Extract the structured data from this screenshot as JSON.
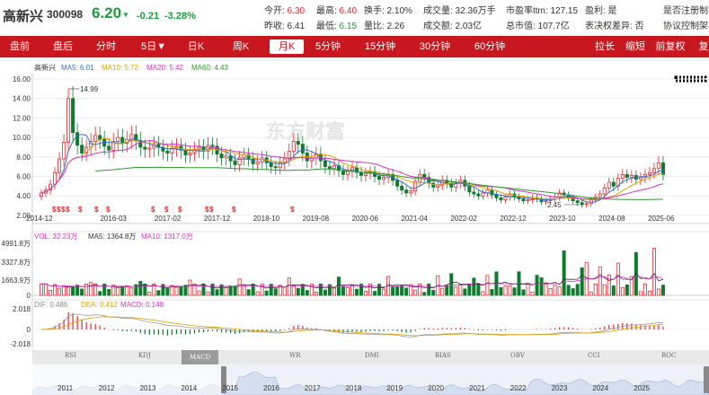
{
  "header": {
    "stock_name": "高新兴",
    "stock_code": "300098",
    "price": "6.20",
    "change": "-0.21",
    "change_pct": "-3.28%",
    "quotes": [
      {
        "label": "今开:",
        "value": "6.30",
        "color": "red"
      },
      {
        "label": "最高:",
        "value": "6.40",
        "color": "red"
      },
      {
        "label": "换手:",
        "value": "2.10%",
        "color": "none"
      },
      {
        "label": "成交量:",
        "value": "32.36万手",
        "color": "none"
      },
      {
        "label": "市盈率ttm:",
        "value": "127.15",
        "color": "none"
      },
      {
        "label": "盈利:",
        "value": "是",
        "color": "none"
      },
      {
        "label": "是否注册制:",
        "value": "",
        "color": "none"
      },
      {
        "label": "昨收:",
        "value": "6.41",
        "color": "none"
      },
      {
        "label": "最低:",
        "value": "6.15",
        "color": "green"
      },
      {
        "label": "量比:",
        "value": "2.26",
        "color": "none"
      },
      {
        "label": "成交额:",
        "value": "2.03亿",
        "color": "none"
      },
      {
        "label": "总市值:",
        "value": "107.7亿",
        "color": "none"
      },
      {
        "label": "表决权差异:",
        "value": "否",
        "color": "none"
      },
      {
        "label": "协议控制架构",
        "value": "",
        "color": "none"
      }
    ]
  },
  "toolbar": {
    "periods": [
      "盘前",
      "盘后",
      "分时",
      "5日▼",
      "日K",
      "周K",
      "月K",
      "5分钟",
      "15分钟",
      "30分钟",
      "60分钟"
    ],
    "active_period": "月K",
    "right_buttons": [
      "拉长",
      "缩短",
      "前复权▼",
      "复"
    ]
  },
  "legend": {
    "name": "高新兴",
    "ma5": "MA5: 6.01",
    "ma10": "MA10: 5.72",
    "ma20": "MA20: 5.42",
    "ma60": "MA60: 4.43"
  },
  "price_axis": [
    "16.00",
    "14.00",
    "12.00",
    "10.00",
    "8.00",
    "6.00",
    "4.00",
    "2.00"
  ],
  "date_axis": [
    "2014-12",
    "2016-03",
    "2017-02",
    "2017-12",
    "2018-10",
    "2019-08",
    "2020-06",
    "2021-04",
    "2022-02",
    "2022-12",
    "2023-10",
    "2024-08",
    "2025-06"
  ],
  "annotations": {
    "high": "14.99",
    "low": "2.45",
    "event_marker": "$"
  },
  "watermark": "东方财富",
  "volume": {
    "axis": [
      "4991.8万",
      "3327.8万",
      "1663.9万",
      "0"
    ],
    "vol": "VOL: 32.23万",
    "ma5": "MA5: 1364.8万",
    "ma10": "MA10: 1317.0万"
  },
  "macd": {
    "axis": [
      "2.018",
      "0",
      "-2.018"
    ],
    "dif": "DIF: 0.486",
    "dea": "DEA: 0.412",
    "macd": "MACD: 0.148"
  },
  "indicator_tabs": [
    "RSI",
    "KDJ",
    "MACD",
    "WR",
    "DMI",
    "BIAS",
    "OBV",
    "CCI",
    "ROC"
  ],
  "active_indicator": "MACD",
  "navigator_years": [
    "2011",
    "2012",
    "2013",
    "2014",
    "2015",
    "2016",
    "2017",
    "2018",
    "2019",
    "2020",
    "2021",
    "2022",
    "2023",
    "2024",
    "2025"
  ],
  "colors": {
    "up": "#e0282d",
    "down": "#0f7b2e",
    "ma5": "#2f6fd6",
    "ma10": "#e0a000",
    "ma20": "#d633c8",
    "ma60": "#2c9a2c",
    "toolbar": "#c8171e"
  },
  "chart_data": {
    "type": "candlestick",
    "title": "",
    "x_start": "2011",
    "first_bar": "2014-12",
    "last_bar": "2025-06",
    "y_range": [
      1,
      16.5
    ],
    "price_high": 14.99,
    "price_low": 2.45,
    "price_last": 6.2
  }
}
